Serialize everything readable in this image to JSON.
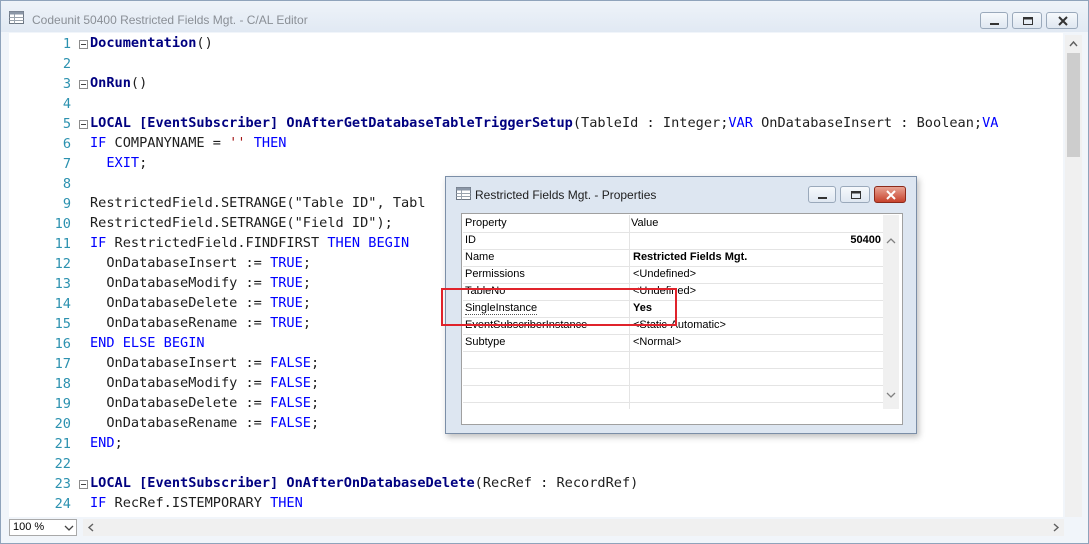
{
  "window": {
    "title": "Codeunit 50400 Restricted Fields Mgt. - C/AL Editor",
    "zoom_value": "100 %"
  },
  "code_lines": [
    {
      "num": "1",
      "fold": true,
      "html": "<span class=\"fn\">Documentation</span>()"
    },
    {
      "num": "2",
      "fold": false,
      "html": ""
    },
    {
      "num": "3",
      "fold": true,
      "html": "<span class=\"fn\">OnRun</span>()"
    },
    {
      "num": "4",
      "fold": false,
      "html": ""
    },
    {
      "num": "5",
      "fold": true,
      "html": "<span class=\"fn\">LOCAL [EventSubscriber] OnAfterGetDatabaseTableTriggerSetup</span>(TableId : Integer;<span class=\"kw\">VAR</span> OnDatabaseInsert : Boolean;<span class=\"kw\">VA</span>"
    },
    {
      "num": "6",
      "fold": false,
      "html": "<span class=\"kw\">IF</span> COMPANYNAME = <span class=\"str\">''</span> <span class=\"kw\">THEN</span>"
    },
    {
      "num": "7",
      "fold": false,
      "html": "  <span class=\"kw\">EXIT</span>;"
    },
    {
      "num": "8",
      "fold": false,
      "html": ""
    },
    {
      "num": "9",
      "fold": false,
      "html": "RestrictedField.SETRANGE(\"Table ID\", Tabl"
    },
    {
      "num": "10",
      "fold": false,
      "html": "RestrictedField.SETRANGE(\"Field ID\");"
    },
    {
      "num": "11",
      "fold": false,
      "html": "<span class=\"kw\">IF</span> RestrictedField.FINDFIRST <span class=\"kw\">THEN BEGIN</span>"
    },
    {
      "num": "12",
      "fold": false,
      "html": "  OnDatabaseInsert := <span class=\"kw\">TRUE</span>;"
    },
    {
      "num": "13",
      "fold": false,
      "html": "  OnDatabaseModify := <span class=\"kw\">TRUE</span>;"
    },
    {
      "num": "14",
      "fold": false,
      "html": "  OnDatabaseDelete := <span class=\"kw\">TRUE</span>;"
    },
    {
      "num": "15",
      "fold": false,
      "html": "  OnDatabaseRename := <span class=\"kw\">TRUE</span>;"
    },
    {
      "num": "16",
      "fold": false,
      "html": "<span class=\"kw\">END ELSE BEGIN</span>"
    },
    {
      "num": "17",
      "fold": false,
      "html": "  OnDatabaseInsert := <span class=\"kw\">FALSE</span>;"
    },
    {
      "num": "18",
      "fold": false,
      "html": "  OnDatabaseModify := <span class=\"kw\">FALSE</span>;"
    },
    {
      "num": "19",
      "fold": false,
      "html": "  OnDatabaseDelete := <span class=\"kw\">FALSE</span>;"
    },
    {
      "num": "20",
      "fold": false,
      "html": "  OnDatabaseRename := <span class=\"kw\">FALSE</span>;"
    },
    {
      "num": "21",
      "fold": false,
      "html": "<span class=\"kw\">END</span>;"
    },
    {
      "num": "22",
      "fold": false,
      "html": ""
    },
    {
      "num": "23",
      "fold": true,
      "html": "<span class=\"fn\">LOCAL [EventSubscriber] OnAfterOnDatabaseDelete</span>(RecRef : RecordRef)"
    },
    {
      "num": "24",
      "fold": false,
      "html": "<span class=\"kw\">IF</span> RecRef.ISTEMPORARY <span class=\"kw\">THEN</span>"
    }
  ],
  "properties_dialog": {
    "title": "Restricted Fields Mgt. - Properties",
    "headers": [
      "Property",
      "Value"
    ],
    "rows": [
      {
        "property": "ID",
        "value": "50400",
        "bold": true,
        "align": "right"
      },
      {
        "property": "Name",
        "value": "Restricted Fields Mgt.",
        "bold": true,
        "align": "left"
      },
      {
        "property": "Permissions",
        "value": "<Undefined>",
        "bold": false,
        "align": "left"
      },
      {
        "property": "TableNo",
        "value": "<Undefined>",
        "bold": false,
        "align": "left"
      },
      {
        "property": "SingleInstance",
        "value": "Yes",
        "bold": true,
        "align": "left",
        "selected": true
      },
      {
        "property": "EventSubscriberInstance",
        "value": "<Static-Automatic>",
        "bold": false,
        "align": "left"
      },
      {
        "property": "Subtype",
        "value": "<Normal>",
        "bold": false,
        "align": "left"
      }
    ]
  }
}
